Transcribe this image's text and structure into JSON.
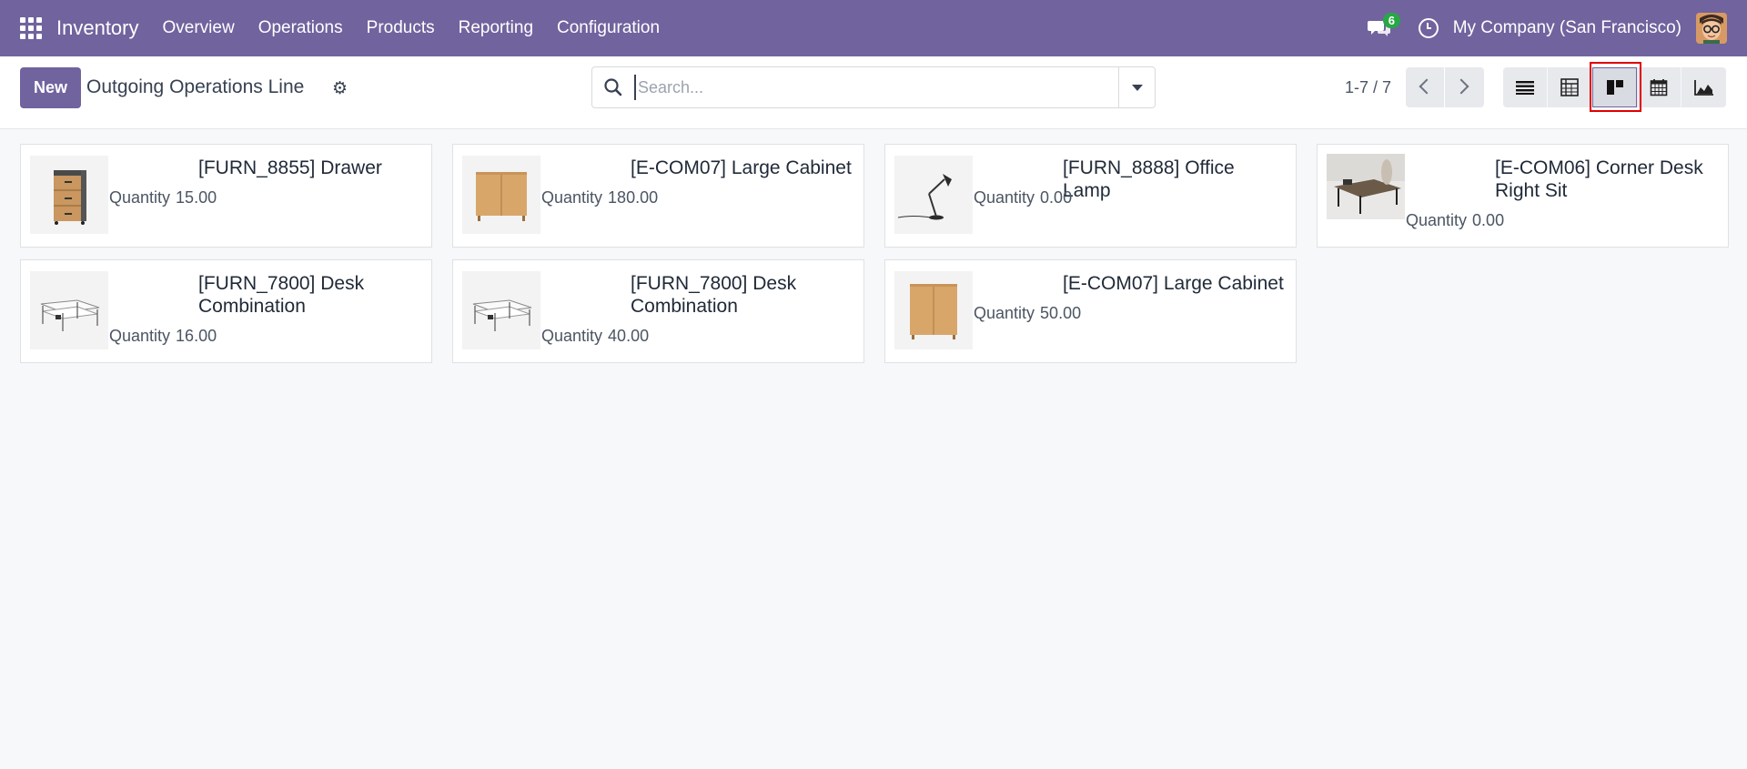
{
  "navbar": {
    "app_name": "Inventory",
    "menu": [
      "Overview",
      "Operations",
      "Products",
      "Reporting",
      "Configuration"
    ],
    "chat_badge": "6",
    "company": "My Company (San Francisco)"
  },
  "control": {
    "new_label": "New",
    "title": "Outgoing Operations Line",
    "search_placeholder": "Search...",
    "pager": "1-7 / 7",
    "active_view": "kanban"
  },
  "cards": [
    {
      "title": "[FURN_8855] Drawer",
      "qty_label": "Quantity",
      "qty": "15.00",
      "image": "drawer"
    },
    {
      "title": "[E-COM07] Large Cabinet",
      "qty_label": "Quantity",
      "qty": "180.00",
      "image": "cabinet"
    },
    {
      "title": "[FURN_8888] Office Lamp",
      "qty_label": "Quantity",
      "qty": "0.00",
      "image": "lamp"
    },
    {
      "title": "[E-COM06] Corner Desk Right Sit",
      "qty_label": "Quantity",
      "qty": "0.00",
      "image": "corner-desk"
    },
    {
      "title": "[FURN_7800] Desk Combination",
      "qty_label": "Quantity",
      "qty": "16.00",
      "image": "desk-combination"
    },
    {
      "title": "[FURN_7800] Desk Combination",
      "qty_label": "Quantity",
      "qty": "40.00",
      "image": "desk-combination"
    },
    {
      "title": "[E-COM07] Large Cabinet",
      "qty_label": "Quantity",
      "qty": "50.00",
      "image": "cabinet"
    }
  ],
  "colors": {
    "brand": "#71639e",
    "badge": "#28a745",
    "highlight": "#e00000"
  }
}
